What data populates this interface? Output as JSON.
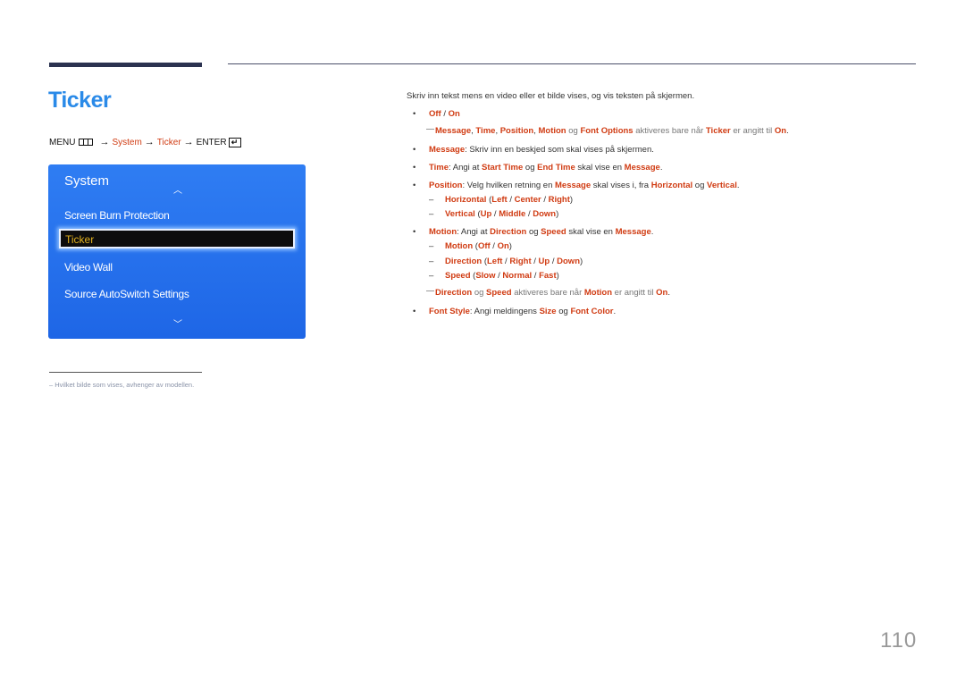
{
  "page": {
    "title": "Ticker",
    "page_number": "110"
  },
  "menu_path": {
    "menu": "MENU",
    "arrow": "→",
    "system": "System",
    "ticker": "Ticker",
    "enter": "ENTER",
    "enter_glyph": "↵"
  },
  "osd": {
    "title": "System",
    "up_glyph": "︿",
    "down_glyph": "﹀",
    "items": [
      {
        "label": "Screen Burn Protection"
      },
      {
        "label": "Ticker",
        "selected": true
      },
      {
        "label": "Video Wall"
      },
      {
        "label": "Source AutoSwitch Settings"
      }
    ],
    "colors": {
      "bg": "#2f7df3",
      "selected_bg": "#0d0d0d",
      "selected_text": "#e0b020"
    }
  },
  "footnote": {
    "dash": "–",
    "text": "Hvilket bilde som vises, avhenger av modellen."
  },
  "content": {
    "intro": "Skriv inn tekst mens en video eller et bilde vises, og vis teksten på skjermen.",
    "bullet": "•",
    "dash": "–",
    "slash": " / ",
    "off_on": {
      "off": "Off",
      "on": "On"
    },
    "note1": {
      "message": "Message",
      "time": "Time",
      "position": "Position",
      "motion": "Motion",
      "og": "og",
      "font_options": "Font Options",
      "mid": "aktiveres bare når",
      "ticker": "Ticker",
      "tail": "er angitt til",
      "on": "On",
      "end": "."
    },
    "message_item": {
      "label": "Message",
      "text": ": Skriv inn en beskjed som skal vises på skjermen."
    },
    "time_item": {
      "label": "Time",
      "t1": ": Angi at ",
      "start": "Start Time",
      "og": " og ",
      "end": "End Time",
      "t2": " skal vise en ",
      "message": "Message",
      "dot": "."
    },
    "position_item": {
      "label": "Position",
      "t1": ": Velg hvilken retning en ",
      "message": "Message",
      "t2": " skal vises i, fra ",
      "horizontal": "Horizontal",
      "og": " og ",
      "vertical": "Vertical",
      "dot": "."
    },
    "horizontal_sub": {
      "label": "Horizontal",
      "options": [
        "Left",
        "Center",
        "Right"
      ]
    },
    "vertical_sub": {
      "label": "Vertical",
      "options": [
        "Up",
        "Middle",
        "Down"
      ]
    },
    "motion_item": {
      "label": "Motion",
      "t1": ": Angi at ",
      "direction": "Direction",
      "og": " og ",
      "speed": "Speed",
      "t2": " skal vise en ",
      "message": "Message",
      "dot": "."
    },
    "motion_sub": {
      "label": "Motion",
      "options": [
        "Off",
        "On"
      ]
    },
    "direction_sub": {
      "label": "Direction",
      "options": [
        "Left",
        "Right",
        "Up",
        "Down"
      ]
    },
    "speed_sub": {
      "label": "Speed",
      "options": [
        "Slow",
        "Normal",
        "Fast"
      ]
    },
    "note2": {
      "direction": "Direction",
      "og": "og",
      "speed": "Speed",
      "mid": "aktiveres bare når",
      "motion": "Motion",
      "tail": "er angitt til",
      "on": "On",
      "end": "."
    },
    "font_style_item": {
      "label": "Font Style",
      "t1": ": Angi meldingens ",
      "size": "Size",
      "og": " og ",
      "color": "Font Color",
      "dot": "."
    },
    "colors": {
      "highlight": "#d03b12",
      "title": "#2a8ae8"
    }
  }
}
